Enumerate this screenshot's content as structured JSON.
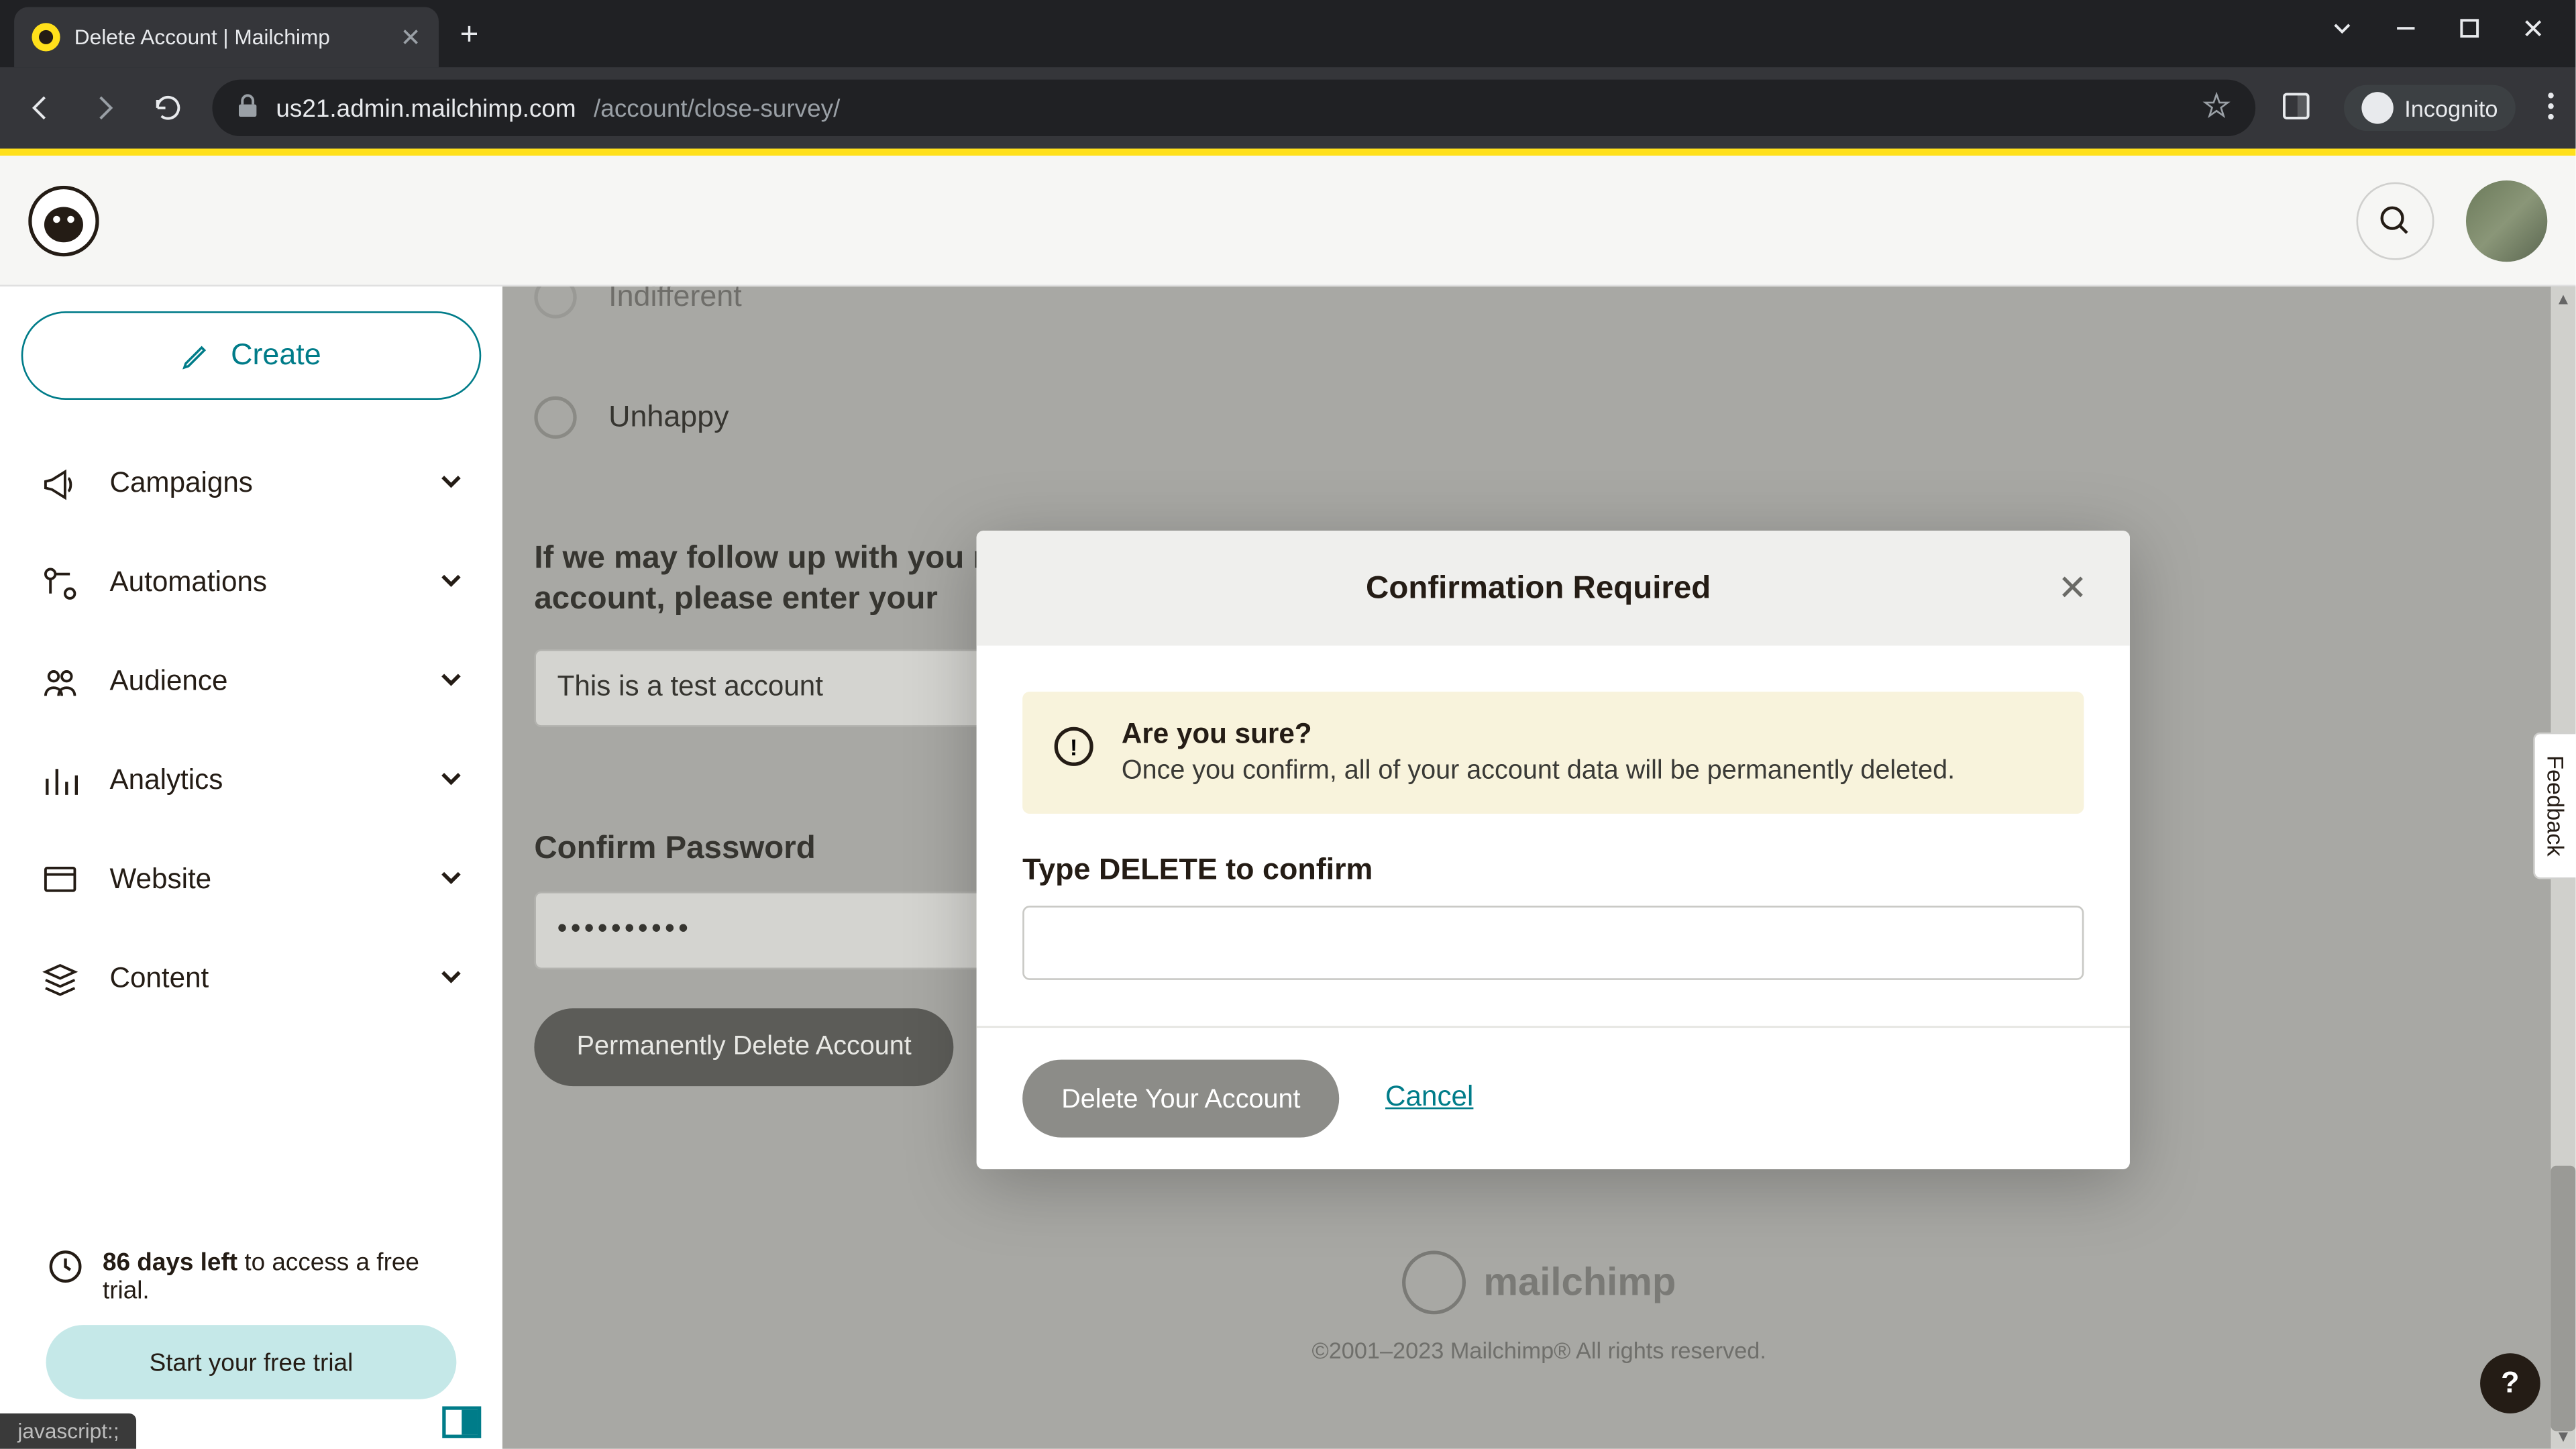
{
  "browser": {
    "tab_title": "Delete Account | Mailchimp",
    "url_host": "us21.admin.mailchimp.com",
    "url_path": "/account/close-survey/",
    "incognito_label": "Incognito",
    "status_text": "javascript:;"
  },
  "sidebar": {
    "create_label": "Create",
    "items": [
      {
        "label": "Campaigns"
      },
      {
        "label": "Automations"
      },
      {
        "label": "Audience"
      },
      {
        "label": "Analytics"
      },
      {
        "label": "Website"
      },
      {
        "label": "Content"
      }
    ],
    "trial": {
      "days_bold": "86 days left",
      "days_rest": " to access a free trial.",
      "cta": "Start your free trial"
    }
  },
  "survey": {
    "radio_partial_label": "Indifferent",
    "radio_unhappy": "Unhappy",
    "followup_q": "If we may follow up with you regarding why you closed your account, please enter your",
    "followup_value": "This is a test account",
    "confirm_pwd_label": "Confirm Password",
    "pwd_value": "••••••••••",
    "delete_btn": "Permanently Delete Account"
  },
  "modal": {
    "title": "Confirmation Required",
    "warn_heading": "Are you sure?",
    "warn_body": "Once you confirm, all of your account data will be permanently deleted.",
    "confirm_label": "Type DELETE to confirm",
    "delete_btn": "Delete Your Account",
    "cancel": "Cancel"
  },
  "footer": {
    "brand": "mailchimp",
    "copyright": "©2001–2023 Mailchimp® All rights reserved."
  },
  "feedback_tab": "Feedback",
  "help": "?"
}
